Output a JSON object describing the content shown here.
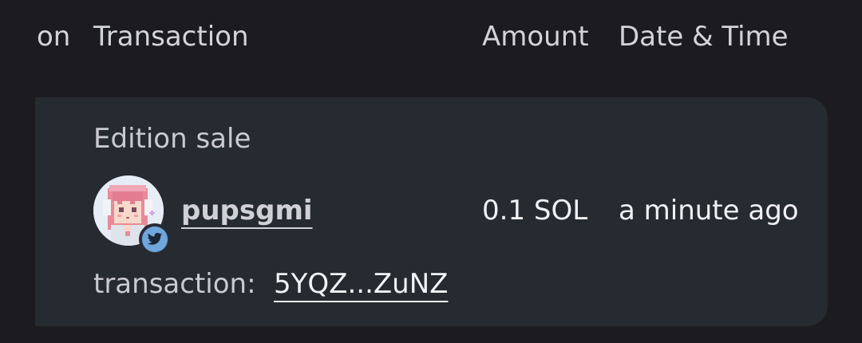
{
  "table_header": {
    "col_partial": "on",
    "col_transaction": "Transaction",
    "col_amount": "Amount",
    "col_datetime": "Date & Time"
  },
  "row": {
    "sale_type": "Edition sale",
    "user": {
      "username": "pupsgmi",
      "avatar_icon": "pixel-art-girl-avatar",
      "badge_icon": "twitter-bird-icon",
      "badge_color": "#6fa7dc"
    },
    "amount": "0.1 SOL",
    "datetime": "a minute ago",
    "transaction_label": "transaction:",
    "transaction_id": "5YQZ...ZuNZ"
  },
  "colors": {
    "background": "#1c1c20",
    "row_background": "#262a31",
    "text_primary": "#f0f1f4",
    "text_secondary": "#c9cbd0"
  }
}
